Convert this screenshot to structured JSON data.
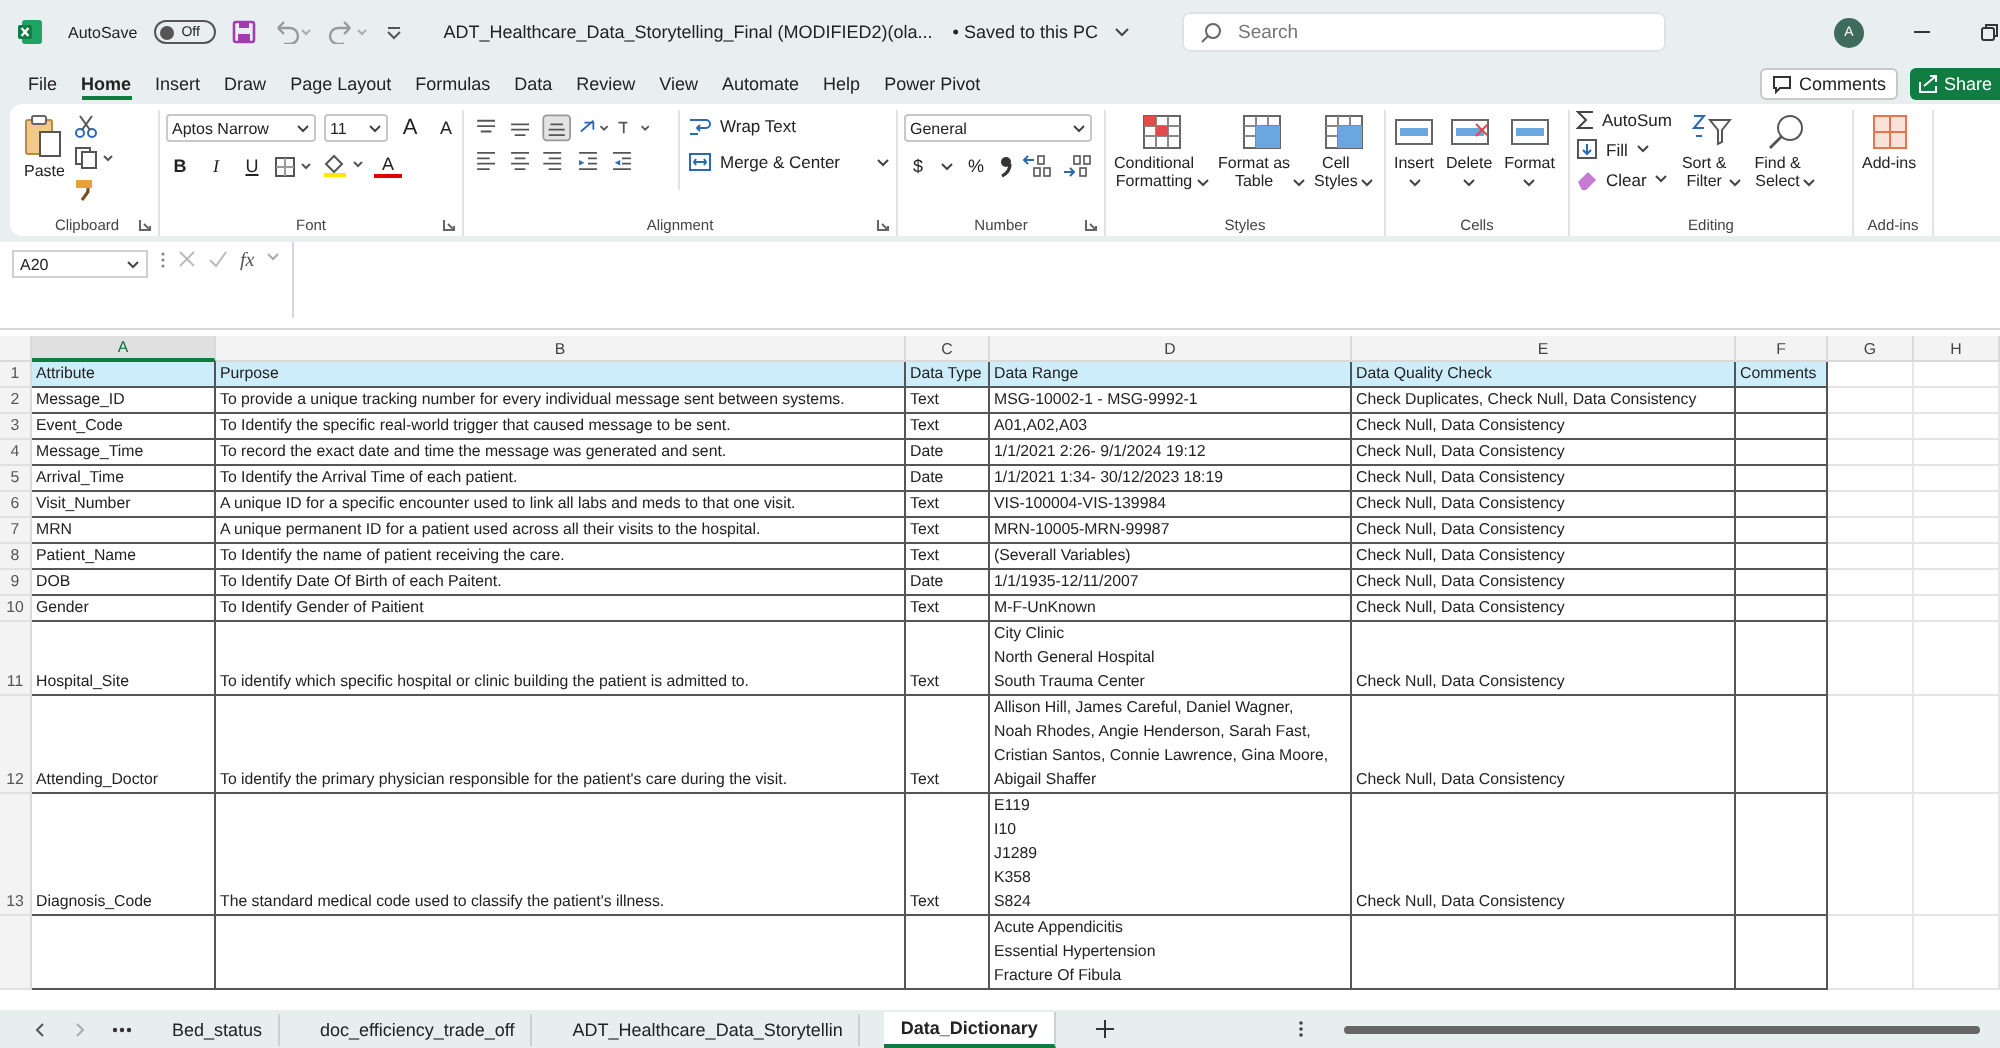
{
  "window": {
    "title": "ADT_Healthcare_Data_Storytelling_Final (MODIFIED2)(ola...",
    "save_status": "• Saved to this PC",
    "autosave": {
      "label": "AutoSave",
      "on": false,
      "state": "Off"
    },
    "search": {
      "placeholder": "Search"
    },
    "account_initial": "A"
  },
  "menu_tabs": [
    {
      "label": "File",
      "selected": false
    },
    {
      "label": "Home",
      "selected": true
    },
    {
      "label": "Insert",
      "selected": false
    },
    {
      "label": "Draw",
      "selected": false
    },
    {
      "label": "Page Layout",
      "selected": false
    },
    {
      "label": "Formulas",
      "selected": false
    },
    {
      "label": "Data",
      "selected": false
    },
    {
      "label": "Review",
      "selected": false
    },
    {
      "label": "View",
      "selected": false
    },
    {
      "label": "Automate",
      "selected": false
    },
    {
      "label": "Help",
      "selected": false
    },
    {
      "label": "Power Pivot",
      "selected": false
    }
  ],
  "comments_button": "Comments",
  "share_button": "Share",
  "ribbon": {
    "clipboard": {
      "label": "Clipboard",
      "paste": "Paste"
    },
    "font": {
      "label": "Font",
      "font_name": "Aptos Narrow",
      "font_size": "11",
      "grow": "A",
      "shrink": "A",
      "bold": "B",
      "italic": "I",
      "underline": "U",
      "font_color": "A"
    },
    "alignment": {
      "label": "Alignment",
      "wrap_text": "Wrap Text",
      "merge_center": "Merge & Center"
    },
    "number": {
      "label": "Number",
      "format": "General",
      "currency": "$",
      "percent": "%"
    },
    "styles": {
      "label": "Styles",
      "conditional": [
        "Conditional",
        "Formatting"
      ],
      "format_table": [
        "Format as",
        "Table"
      ],
      "cell_styles": [
        "Cell",
        "Styles"
      ]
    },
    "cells": {
      "label": "Cells",
      "insert": "Insert",
      "delete": "Delete",
      "format": "Format"
    },
    "editing": {
      "label": "Editing",
      "autosum": "AutoSum",
      "fill": "Fill",
      "clear": "Clear",
      "sort": [
        "Sort &",
        "Filter"
      ],
      "find": [
        "Find &",
        "Select"
      ]
    },
    "addins": {
      "label": "Add-ins",
      "button": "Add-ins"
    }
  },
  "formula_bar": {
    "name_box": "A20",
    "fx": "fx"
  },
  "sheet": {
    "columns": [
      {
        "label": "A",
        "selected": true
      },
      {
        "label": "B",
        "selected": false
      },
      {
        "label": "C",
        "selected": false
      },
      {
        "label": "D",
        "selected": false
      },
      {
        "label": "E",
        "selected": false
      },
      {
        "label": "F",
        "selected": false
      },
      {
        "label": "G",
        "selected": false
      },
      {
        "label": "H",
        "selected": false
      }
    ],
    "rows": [
      {
        "number": "1",
        "kind": "header",
        "cells": {
          "A": "Attribute",
          "B": "Purpose",
          "C": "Data Type",
          "D": "Data Range",
          "E": "Data Quality Check",
          "F": "Comments"
        }
      },
      {
        "number": "2",
        "kind": "data",
        "cells": {
          "A": "Message_ID",
          "B": "To provide a unique tracking number for every individual message sent between systems.",
          "C": "Text",
          "D": "MSG-10002-1 - MSG-9992-1",
          "E": "Check Duplicates, Check Null, Data Consistency"
        }
      },
      {
        "number": "3",
        "kind": "data",
        "cells": {
          "A": "Event_Code",
          "B": "To Identify the specific real-world trigger that caused message to be sent.",
          "C": "Text",
          "D": "A01,A02,A03",
          "E": "Check Null, Data Consistency"
        }
      },
      {
        "number": "4",
        "kind": "data",
        "cells": {
          "A": "Message_Time",
          "B": "To record the exact date and time the message was generated and sent.",
          "C": "Date",
          "D": "1/1/2021 2:26- 9/1/2024 19:12",
          "E": "Check Null, Data Consistency"
        }
      },
      {
        "number": "5",
        "kind": "data",
        "cells": {
          "A": "Arrival_Time",
          "B": "To Identify the Arrival Time of each patient.",
          "C": "Date",
          "D": "1/1/2021 1:34- 30/12/2023 18:19",
          "E": "Check Null, Data Consistency"
        }
      },
      {
        "number": "6",
        "kind": "data",
        "cells": {
          "A": "Visit_Number",
          "B": "A unique ID for a specific encounter used to link all labs and meds to that one visit.",
          "C": "Text",
          "D": "VIS-100004-VIS-139984",
          "E": "Check Null, Data Consistency"
        }
      },
      {
        "number": "7",
        "kind": "data",
        "cells": {
          "A": "MRN",
          "B": "A unique permanent ID for a patient used across all their visits to the hospital.",
          "C": "Text",
          "D": "MRN-10005-MRN-99987",
          "E": "Check Null, Data Consistency"
        }
      },
      {
        "number": "8",
        "kind": "data",
        "cells": {
          "A": "Patient_Name",
          "B": "To Identify the name of patient receiving the care.",
          "C": "Text",
          "D": "(Severall Variables)",
          "E": "Check Null, Data Consistency"
        }
      },
      {
        "number": "9",
        "kind": "data",
        "cells": {
          "A": "DOB",
          "B": "To Identify Date Of Birth of each Paitent.",
          "C": "Date",
          "D": "1/1/1935-12/11/2007",
          "E": "Check Null, Data Consistency"
        }
      },
      {
        "number": "10",
        "kind": "data",
        "cells": {
          "A": "Gender",
          "B": "To Identify Gender of Paitient",
          "C": "Text",
          "D": "M-F-UnKnown",
          "E": "Check Null, Data Consistency"
        }
      },
      {
        "number": "11",
        "kind": "data",
        "cells": {
          "A": "Hospital_Site",
          "B": "To identify which specific hospital or clinic building the patient is admitted to.",
          "C": "Text",
          "D": "City Clinic\nNorth General Hospital\nSouth Trauma Center",
          "E": "Check Null, Data Consistency"
        }
      },
      {
        "number": "12",
        "kind": "data",
        "cells": {
          "A": "Attending_Doctor",
          "B": "To identify the primary physician responsible for the patient's care during the visit.",
          "C": "Text",
          "D": "Allison Hill, James Careful, Daniel Wagner,\nNoah Rhodes, Angie Henderson, Sarah Fast,\nCristian Santos, Connie Lawrence, Gina Moore,\nAbigail Shaffer",
          "E": "Check Null, Data Consistency"
        }
      },
      {
        "number": "13",
        "kind": "data",
        "cells": {
          "A": "Diagnosis_Code",
          "B": "The standard medical code used to classify the patient's illness.",
          "C": "Text",
          "D": "E119\nI10\nJ1289\nK358\nS824",
          "E": "Check Null, Data Consistency"
        }
      },
      {
        "kind": "data",
        "cells": {
          "D": "Acute Appendicitis\nEssential Hypertension\nFracture Of Fibula"
        }
      }
    ]
  },
  "sheet_tabs": [
    {
      "label": "Bed_status",
      "selected": false
    },
    {
      "label": "doc_efficiency_trade_off",
      "selected": false
    },
    {
      "label": "ADT_Healthcare_Data_Storytellin",
      "selected": false
    },
    {
      "label": "Data_Dictionary",
      "selected": true
    }
  ]
}
